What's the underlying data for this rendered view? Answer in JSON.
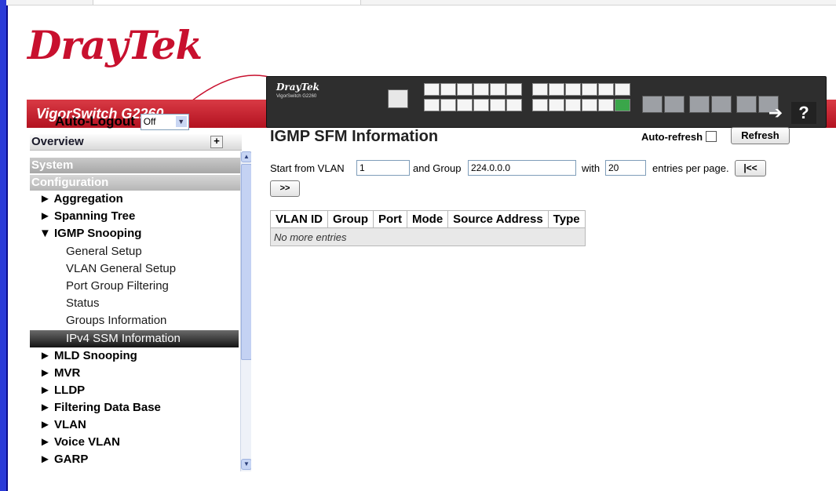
{
  "header": {
    "logo_dray": "Dray",
    "logo_tek": "Tek",
    "model": "VigorSwitch G2260",
    "panel_brand": "DrayTek",
    "panel_model": "VigorSwitch G2260",
    "nav_logout_glyph": "➔",
    "nav_help_glyph": "?"
  },
  "sidebar": {
    "auto_logout_label": "Auto-Logout",
    "auto_logout_value": "Off",
    "overview": "Overview",
    "system": "System",
    "configuration": "Configuration",
    "items": [
      {
        "label": "► Aggregation"
      },
      {
        "label": "► Spanning Tree"
      },
      {
        "label": "▼ IGMP Snooping"
      }
    ],
    "sub_items": [
      {
        "label": "General Setup"
      },
      {
        "label": "VLAN General Setup"
      },
      {
        "label": "Port Group Filtering"
      },
      {
        "label": "Status"
      },
      {
        "label": "Groups Information"
      },
      {
        "label": "IPv4 SSM Information"
      }
    ],
    "items_after": [
      {
        "label": "► MLD Snooping"
      },
      {
        "label": "► MVR"
      },
      {
        "label": "► LLDP"
      },
      {
        "label": "► Filtering Data Base"
      },
      {
        "label": "► VLAN"
      },
      {
        "label": "► Voice VLAN"
      },
      {
        "label": "► GARP"
      }
    ]
  },
  "main": {
    "title": "IGMP SFM Information",
    "auto_refresh_label": "Auto-refresh",
    "refresh_button": "Refresh",
    "start_from_vlan_label": "Start from VLAN",
    "start_vlan_value": "1",
    "and_group_label": "and Group",
    "group_value": "224.0.0.0",
    "with_label": "with",
    "entries_value": "20",
    "entries_per_page_label": "entries per page.",
    "first_button": "|<<",
    "next_button": ">>",
    "table": {
      "columns": [
        "VLAN ID",
        "Group",
        "Port",
        "Mode",
        "Source Address",
        "Type"
      ],
      "empty_text": "No more entries"
    }
  }
}
